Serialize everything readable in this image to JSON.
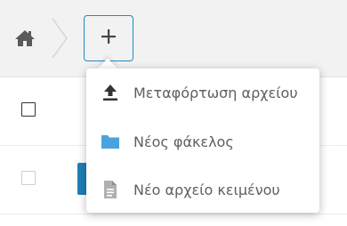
{
  "toolbar": {
    "home_icon": "home-icon",
    "new_button_icon": "plus-icon",
    "accent_color": "#1e8bc3"
  },
  "new_menu": {
    "items": [
      {
        "label": "Μεταφόρτωση αρχείου",
        "icon": "upload-icon",
        "color": "#333333"
      },
      {
        "label": "Νέος φάκελος",
        "icon": "folder-icon",
        "color": "#4aa3df"
      },
      {
        "label": "Νέο αρχείο κειμένου",
        "icon": "text-file-icon",
        "color": "#b0b0b0"
      }
    ]
  },
  "file_list": {
    "rows": [
      {
        "checkbox_checked": false
      },
      {
        "checkbox_checked": false
      }
    ]
  }
}
